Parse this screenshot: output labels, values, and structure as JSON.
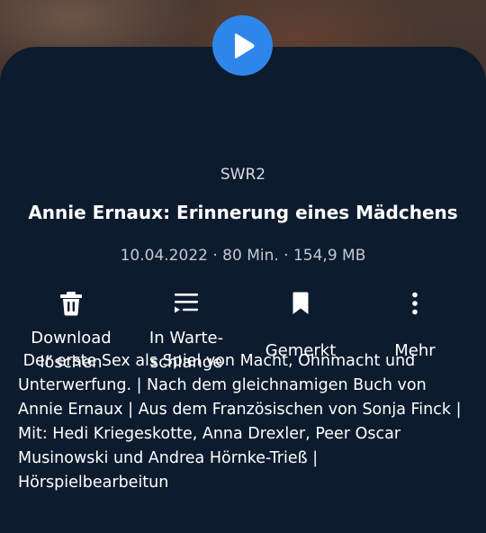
{
  "episode": {
    "source": "SWR2",
    "title": "Annie Ernaux: Erinnerung eines Mädchens",
    "meta": "10.04.2022 · 80 Min. · 154,9 MB",
    "description": " Der erste Sex als Spiel von Macht, Ohnmacht und Unterwerfung. | Nach dem gleichnamigen Buch von Annie Ernaux | Aus dem Französischen von Sonja Finck | Mit: Hedi Kriegeskotte, Anna Drexler, Peer Oscar Musinowski und Andrea Hörnke-Trieß | Hörspielbearbeitun"
  },
  "actions": {
    "download": {
      "line1": "Download",
      "line2": "löschen",
      "icon": "trash-icon"
    },
    "queue": {
      "line1": "In Warte-",
      "line2": "schlange",
      "icon": "queue-icon"
    },
    "bookmark": {
      "label": "Gemerkt",
      "icon": "bookmark-icon"
    },
    "more": {
      "label": "Mehr",
      "icon": "more-vertical-icon"
    }
  },
  "player": {
    "icon": "play-icon",
    "accent": "#2f86ea"
  },
  "colors": {
    "sheet": "#0d1b2e",
    "text": "#ffffff",
    "muted": "#c3c9d2"
  }
}
